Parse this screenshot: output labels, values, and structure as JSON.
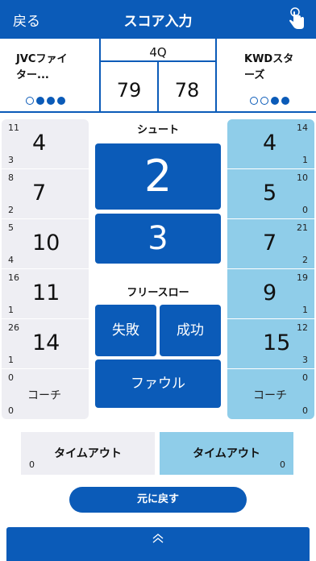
{
  "header": {
    "back_label": "戻る",
    "title": "スコア入力"
  },
  "score": {
    "home_team": "JVCファイ\nター...",
    "away_team": "KWDスタ\nーズ",
    "quarter": "4Q",
    "home_score": "79",
    "away_score": "78",
    "home_dots": [
      false,
      true,
      true,
      true
    ],
    "away_dots": [
      false,
      false,
      true,
      true
    ]
  },
  "left_players": [
    {
      "top": "11",
      "bottom": "3",
      "number": "4"
    },
    {
      "top": "8",
      "bottom": "2",
      "number": "7"
    },
    {
      "top": "5",
      "bottom": "4",
      "number": "10"
    },
    {
      "top": "16",
      "bottom": "1",
      "number": "11"
    },
    {
      "top": "26",
      "bottom": "1",
      "number": "14"
    }
  ],
  "left_coach": {
    "top": "0",
    "bottom": "0",
    "label": "コーチ"
  },
  "right_players": [
    {
      "top": "14",
      "bottom": "1",
      "number": "4"
    },
    {
      "top": "10",
      "bottom": "0",
      "number": "5"
    },
    {
      "top": "21",
      "bottom": "2",
      "number": "7"
    },
    {
      "top": "19",
      "bottom": "1",
      "number": "9"
    },
    {
      "top": "12",
      "bottom": "3",
      "number": "15"
    }
  ],
  "right_coach": {
    "top": "0",
    "bottom": "0",
    "label": "コーチ"
  },
  "center": {
    "shoot_label": "シュート",
    "two_label": "2",
    "three_label": "3",
    "freethrow_label": "フリースロー",
    "miss_label": "失敗",
    "success_label": "成功",
    "foul_label": "ファウル"
  },
  "timeouts": {
    "label": "タイムアウト",
    "home_count": "0",
    "away_count": "0"
  },
  "undo_label": "元に戻す",
  "colors": {
    "primary": "#0b5bb8",
    "home_bg": "#eeeef3",
    "away_bg": "#8fcde9"
  }
}
